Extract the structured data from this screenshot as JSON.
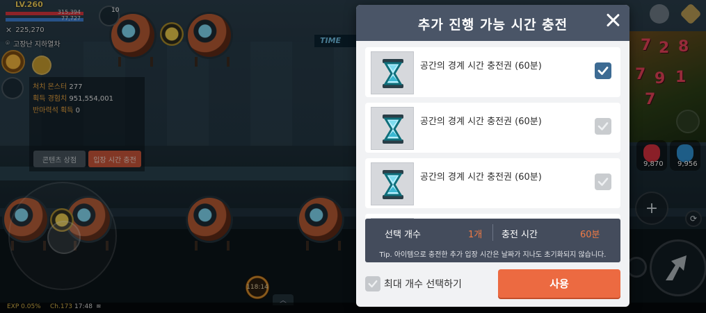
{
  "hud": {
    "level": "LV.260",
    "hp_text": "315,394",
    "mp_text": "77,727",
    "combat_power": "225,270",
    "location": "고장난 지하열차",
    "buff_count": "10",
    "time_sign": "TIME",
    "exp_text": "EXP 0.05%",
    "channel_text": "Ch.173",
    "clock": "17:48",
    "timer": "118:14",
    "potion1_count": "9,870",
    "potion2_count": "9,956",
    "dice_numbers": [
      "7",
      "2",
      "8",
      "7",
      "9",
      "1",
      "7"
    ],
    "colors": {
      "hp": "#d9363e",
      "mp": "#3c7fd1",
      "accent_orange": "#e9a43f"
    }
  },
  "info_panel": {
    "rows": [
      {
        "key": "처치 몬스터",
        "value": "277"
      },
      {
        "key": "획득 경험치",
        "value": "951,554,001"
      },
      {
        "key": "반마력석 획득",
        "value": "0"
      }
    ],
    "content_shop_button": "콘텐츠 상점",
    "charge_time_button": "입장 시간 충전"
  },
  "modal": {
    "title": "추가 진행 가능 시간 충전",
    "close_icon": "close-icon",
    "items": [
      {
        "label": "공간의 경계 시간 충전권 (60분)",
        "checked": true,
        "icon": "hourglass-icon"
      },
      {
        "label": "공간의 경계 시간 충전권 (60분)",
        "checked": false,
        "icon": "hourglass-icon"
      },
      {
        "label": "공간의 경계 시간 충전권 (60분)",
        "checked": false,
        "icon": "hourglass-icon"
      }
    ],
    "summary": {
      "count_label": "선택 개수",
      "count_value": "1개",
      "time_label": "충전 시간",
      "time_value": "60분",
      "tip": "Tip. 아이템으로 충전한 추가 입장 시간은 날짜가 지나도 초기화되지 않습니다."
    },
    "max_select_label": "최대 개수 선택하기",
    "use_button": "사용",
    "colors": {
      "header": "#4a5567",
      "checkbox_on": "#3d6b93",
      "use_button": "#ec6a41",
      "value_orange": "#ef7a45"
    }
  }
}
